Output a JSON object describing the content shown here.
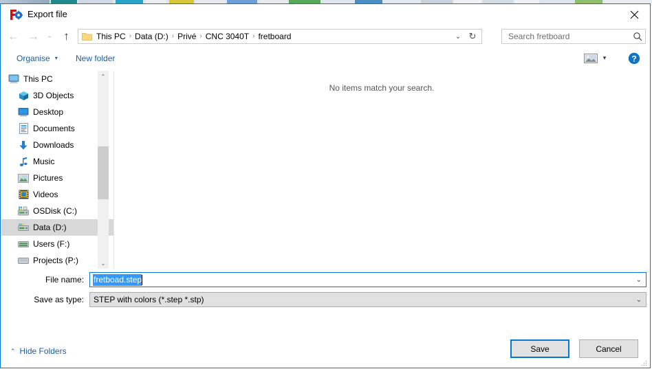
{
  "background": {
    "description": "partially visible application toolbar behind dialog"
  },
  "window": {
    "title": "Export file",
    "app_icon": "freecad-icon",
    "close_label": "✕",
    "accent_color": "#0078d7"
  },
  "nav": {
    "back_icon": "←",
    "forward_icon": "→",
    "recent_icon": "⌄",
    "up_icon": "↑",
    "back_name": "back-button",
    "forward_name": "forward-button",
    "up_name": "up-button"
  },
  "address": {
    "folder_icon": "folder-icon",
    "separator": "›",
    "crumbs": [
      "This PC",
      "Data (D:)",
      "Privé",
      "CNC 3040T",
      "fretboard"
    ],
    "chevron": "⌄",
    "refresh_icon": "↻"
  },
  "search": {
    "placeholder": "Search fretboard",
    "value": "",
    "icon": "search-icon"
  },
  "toolbar": {
    "organise_label": "Organise",
    "organise_caret": "▾",
    "new_folder_label": "New folder",
    "view_icon": "change-view-icon",
    "view_caret": "▾",
    "help_icon": "?"
  },
  "sidebar": {
    "items": [
      {
        "label": "This PC",
        "icon": "monitor-icon",
        "level": 0,
        "selected": false
      },
      {
        "label": "3D Objects",
        "icon": "cube-icon",
        "level": 1,
        "selected": false
      },
      {
        "label": "Desktop",
        "icon": "desktop-icon",
        "level": 1,
        "selected": false
      },
      {
        "label": "Documents",
        "icon": "document-icon",
        "level": 1,
        "selected": false
      },
      {
        "label": "Downloads",
        "icon": "download-icon",
        "level": 1,
        "selected": false
      },
      {
        "label": "Music",
        "icon": "music-note-icon",
        "level": 1,
        "selected": false
      },
      {
        "label": "Pictures",
        "icon": "picture-icon",
        "level": 1,
        "selected": false
      },
      {
        "label": "Videos",
        "icon": "video-icon",
        "level": 1,
        "selected": false
      },
      {
        "label": "OSDisk (C:)",
        "icon": "windows-drive-icon",
        "level": 1,
        "selected": false
      },
      {
        "label": "Data (D:)",
        "icon": "drive-icon",
        "level": 1,
        "selected": true
      },
      {
        "label": "Users (F:)",
        "icon": "drive-icon",
        "level": 1,
        "selected": false
      },
      {
        "label": "Projects (P:)",
        "icon": "drive-icon",
        "level": 1,
        "selected": false
      }
    ],
    "scroll_up_icon": "⌃",
    "scroll_down_icon": "⌄"
  },
  "filelist": {
    "empty_message": "No items match your search."
  },
  "form": {
    "filename_label": "File name:",
    "filename_value": "fretboad.step",
    "filename_selected": true,
    "filename_chevron": "⌄",
    "savetype_label": "Save as type:",
    "savetype_value": "STEP with colors (*.step *.stp)",
    "savetype_chevron": "⌄"
  },
  "footer": {
    "hide_folders_label": "Hide Folders",
    "hide_folders_caret": "⌃",
    "save_label": "Save",
    "cancel_label": "Cancel"
  }
}
